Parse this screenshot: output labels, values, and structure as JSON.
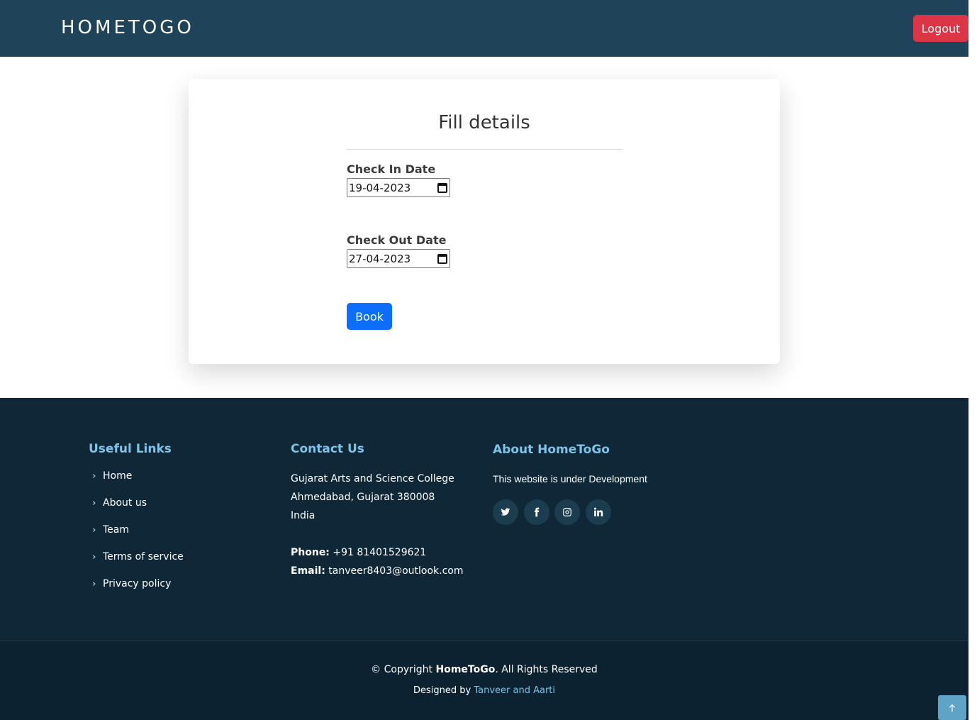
{
  "header": {
    "logo": "HOMETOGO",
    "logout_label": "Logout"
  },
  "form": {
    "title": "Fill details",
    "check_in_label": "Check In Date",
    "check_in_value": "19-04-2023",
    "check_out_label": "Check Out Date",
    "check_out_value": "27-04-2023",
    "book_label": "Book"
  },
  "footer": {
    "useful_links_title": "Useful Links",
    "links": [
      "Home",
      "About us",
      "Team",
      "Terms of service",
      "Privacy policy"
    ],
    "contact_title": "Contact Us",
    "address": [
      "Gujarat Arts and Science College",
      "Ahmedabad, Gujarat 380008",
      "India"
    ],
    "phone_label": "Phone:",
    "phone": "+91 81401529621",
    "email_label": "Email:",
    "email": "tanveer8403@outlook.com",
    "about_title": "About HomeToGo",
    "about_text": "This website is under Development",
    "social": [
      "twitter-icon",
      "facebook-icon",
      "instagram-icon",
      "linkedin-icon"
    ],
    "copyright_prefix": "© Copyright",
    "copyright_brand": "HomeToGo",
    "copyright_suffix": ". All Rights Reserved",
    "designed_prefix": "Designed by",
    "designed_by": "Tanveer and Aarti"
  },
  "colors": {
    "header_bg": "#1f4459",
    "logout": "#dc3545",
    "book": "#0d6efd",
    "footer_bg": "#0f2737",
    "accent": "#7fc3e8"
  }
}
